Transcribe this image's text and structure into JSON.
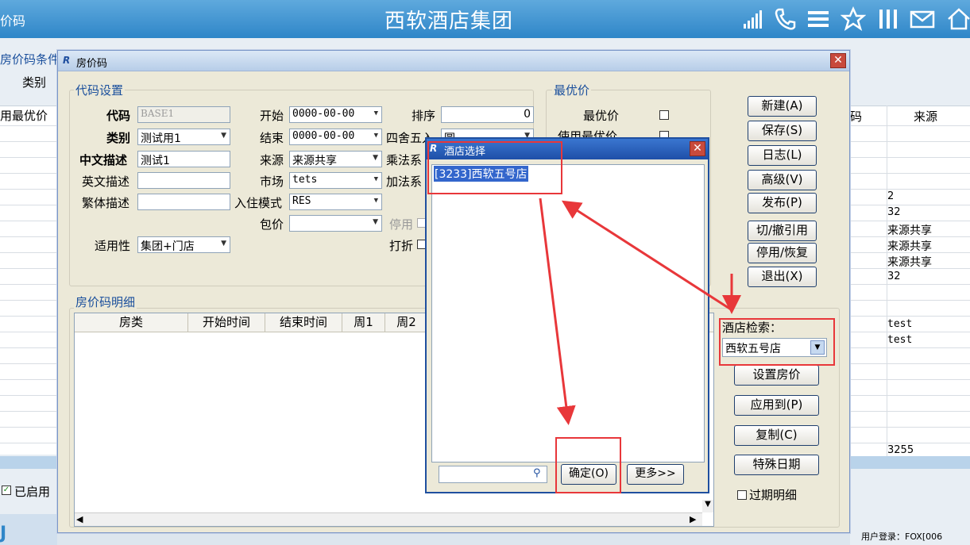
{
  "topbar": {
    "left_label": "价码",
    "title": "西软酒店集团",
    "icons": [
      "signal-icon",
      "phone-icon",
      "menu-icon",
      "star-icon",
      "columns-icon",
      "mail-icon",
      "home-icon"
    ]
  },
  "bg": {
    "condition_label": "房价码条件",
    "category_label": "类别",
    "col_best": "用最优价",
    "col_code": "码",
    "col_source": "来源",
    "source_values": [
      "2",
      "32",
      "来源共享",
      "来源共享",
      "来源共享",
      "32",
      "test",
      "test",
      "3255"
    ],
    "enabled_label": "已启用",
    "user_login": "用户登录：FOX[006",
    "icons": [
      "app-logo-icon"
    ]
  },
  "dialog": {
    "title": "房价码",
    "code_settings": {
      "group_title": "代码设置",
      "code_label": "代码",
      "code_value": "BASE1",
      "category_label": "类别",
      "category_value": "测试用1",
      "cn_desc_label": "中文描述",
      "cn_desc_value": "测试1",
      "en_desc_label": "英文描述",
      "en_desc_value": "",
      "tw_desc_label": "繁体描述",
      "tw_desc_value": "",
      "start_label": "开始",
      "start_value": "0000-00-00",
      "end_label": "结束",
      "end_value": "0000-00-00",
      "source_label": "来源",
      "source_value": "来源共享",
      "market_label": "市场",
      "market_value": "tets",
      "checkin_label": "入住模式",
      "checkin_value": "RES",
      "package_label": "包价",
      "package_value": "",
      "applicability_label": "适用性",
      "applicability_value": "集团+门店",
      "sort_label": "排序",
      "sort_value": "0",
      "rounding_label": "四舍五入",
      "rounding_value": "圆",
      "multiply_label": "乘法系",
      "add_label": "加法系",
      "disable_label": "停用",
      "discount_label": "打折"
    },
    "best_price": {
      "group_title": "最优价",
      "best_label": "最优价",
      "use_best_label": "使用最优价"
    },
    "buttons": {
      "new": "新建(A)",
      "save": "保存(S)",
      "log": "日志(L)",
      "advanced": "高级(V)",
      "publish": "发布(P)",
      "cut_quote": "切/撤引用",
      "disable_restore": "停用/恢复",
      "exit": "退出(X)"
    },
    "detail": {
      "group_title": "房价码明细",
      "columns": [
        "房类",
        "开始时间",
        "结束时间",
        "周1",
        "周2"
      ]
    },
    "hotel_search": {
      "label": "酒店检索：",
      "value": "西软五号店"
    },
    "right_buttons": {
      "set_price": "设置房价",
      "apply_to": "应用到(P)",
      "copy": "复制(C)",
      "special_date": "特殊日期"
    },
    "expired_detail_label": "过期明细"
  },
  "hotel_select": {
    "title": "酒店选择",
    "items": [
      "[3233]西软五号店"
    ],
    "search_value": "",
    "ok_button": "确定(O)",
    "more_button": "更多>>"
  },
  "colors": {
    "topbar": "#2f86c8",
    "dialog_bg": "#ece9d8",
    "highlight": "#e8373a",
    "selection": "#3366cc"
  }
}
